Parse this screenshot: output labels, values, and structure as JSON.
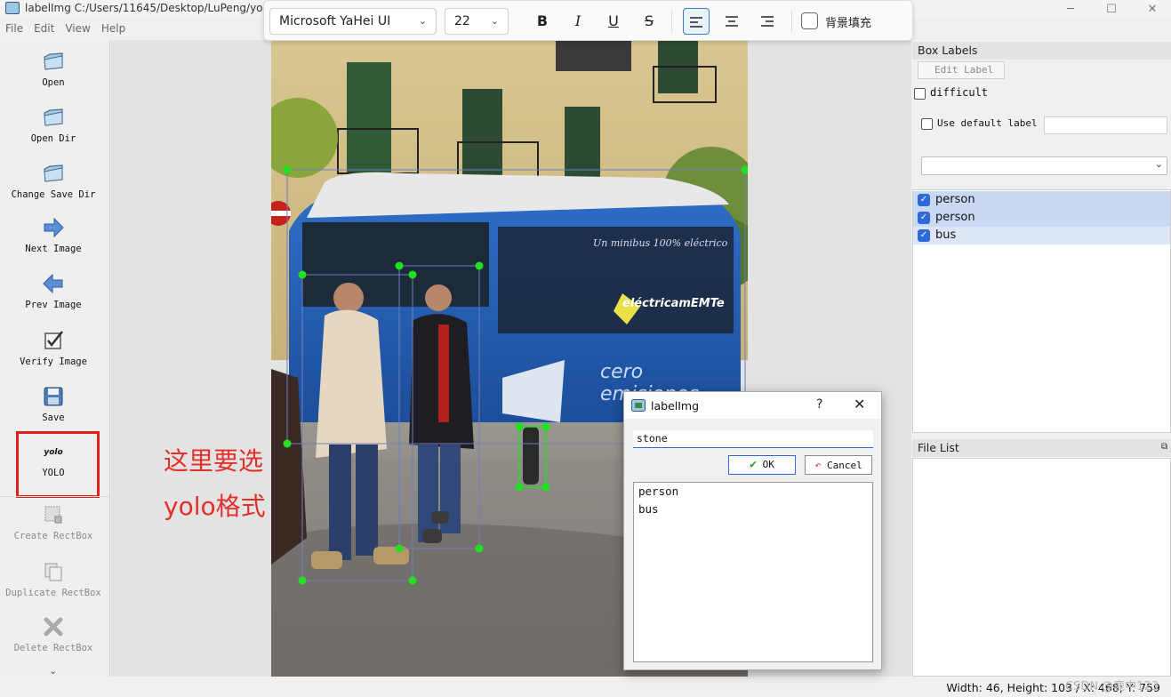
{
  "window": {
    "title": "labelImg C:/Users/11645/Desktop/LuPeng/yolov",
    "minimize": "─",
    "maximize": "☐",
    "close": "✕"
  },
  "menu": [
    "File",
    "Edit",
    "View",
    "Help"
  ],
  "toolbar": [
    {
      "name": "open",
      "label": "Open",
      "icon": "folder-icon"
    },
    {
      "name": "open-dir",
      "label": "Open Dir",
      "icon": "folder-icon"
    },
    {
      "name": "change-save-dir",
      "label": "Change Save Dir",
      "icon": "folder-icon"
    },
    {
      "name": "next-image",
      "label": "Next Image",
      "icon": "arrow-right-icon"
    },
    {
      "name": "prev-image",
      "label": "Prev Image",
      "icon": "arrow-left-icon"
    },
    {
      "name": "verify-image",
      "label": "Verify Image",
      "icon": "checkbox-icon"
    },
    {
      "name": "save",
      "label": "Save",
      "icon": "floppy-icon"
    },
    {
      "name": "yolo",
      "label": "YOLO",
      "icon_text": "yolo"
    },
    {
      "name": "create-rectbox",
      "label": "Create RectBox",
      "icon": "rectbox-icon"
    },
    {
      "name": "duplicate-rectbox",
      "label": "Duplicate RectBox",
      "icon": "duplicate-icon"
    },
    {
      "name": "delete-rectbox",
      "label": "Delete RectBox",
      "icon": "delete-icon"
    }
  ],
  "toolbar_more": "⌄",
  "format_bar": {
    "font": "Microsoft YaHei UI",
    "size": "22",
    "bold": "B",
    "italic": "I",
    "underline": "U",
    "strike": "S",
    "fill_label": "背景填充"
  },
  "annotation": {
    "line1": "这里要选",
    "line2": "yolo格式",
    "color": "#e4302b"
  },
  "right_panel": {
    "box_labels_title": "Box Labels",
    "edit_label": "Edit Label",
    "difficult": "difficult",
    "use_default_label": "Use default label",
    "labels": [
      {
        "text": "person",
        "checked": true
      },
      {
        "text": "person",
        "checked": true
      },
      {
        "text": "bus",
        "checked": true
      }
    ],
    "file_list_title": "File List"
  },
  "dialog": {
    "title": "labelImg",
    "help": "?",
    "close": "✕",
    "input_value": "stone",
    "ok": "OK",
    "cancel": "Cancel",
    "options": [
      "person",
      "bus"
    ]
  },
  "status": {
    "text": "Width: 46, Height: 103 / X: 468; Y: 759",
    "watermark": "CSDN @鹿中123"
  },
  "colors": {
    "accent": "#2f6ad6",
    "handle": "#22e022",
    "box_outline": "#7080c0"
  }
}
